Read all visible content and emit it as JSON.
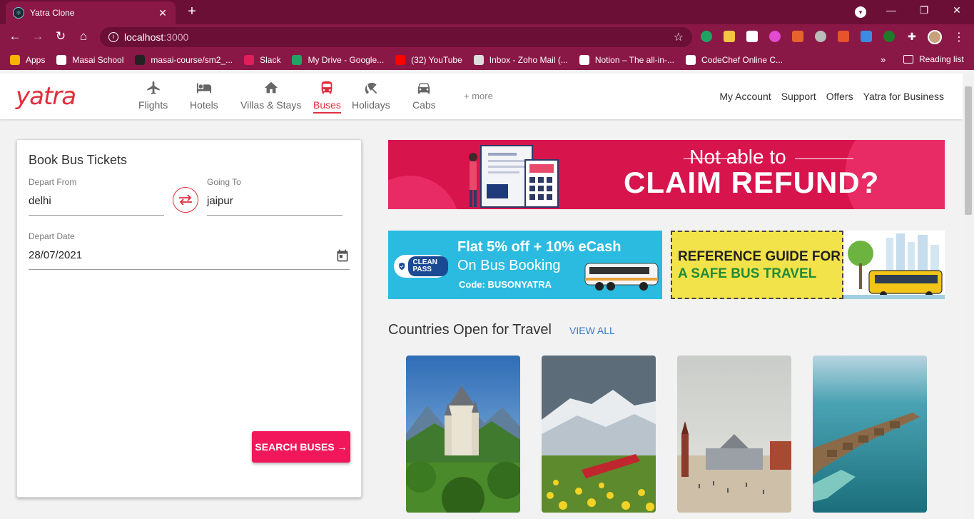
{
  "browser": {
    "tab_title": "Yatra Clone",
    "url_host": "localhost",
    "url_port": ":3000",
    "bookmarks": [
      {
        "label": "Apps",
        "color": "#f4b400"
      },
      {
        "label": "Masai School",
        "color": "#ffffff"
      },
      {
        "label": "masai-course/sm2_...",
        "color": "#222222"
      },
      {
        "label": "Slack",
        "color": "#e01e5a"
      },
      {
        "label": "My Drive - Google...",
        "color": "#1fa463"
      },
      {
        "label": "(32) YouTube",
        "color": "#ff0000"
      },
      {
        "label": "Inbox - Zoho Mail (...",
        "color": "#dddddd"
      },
      {
        "label": "Notion – The all-in-...",
        "color": "#ffffff"
      },
      {
        "label": "CodeChef Online C...",
        "color": "#ffffff"
      }
    ],
    "reading_list": "Reading list",
    "overflow": "»"
  },
  "header": {
    "logo": "yatra",
    "nav": [
      {
        "label": "Flights",
        "icon": "plane-icon"
      },
      {
        "label": "Hotels",
        "icon": "bed-icon"
      },
      {
        "label": "Villas & Stays",
        "icon": "home-icon"
      },
      {
        "label": "Buses",
        "icon": "bus-icon"
      },
      {
        "label": "Holidays",
        "icon": "umbrella-icon"
      },
      {
        "label": "Cabs",
        "icon": "car-icon"
      }
    ],
    "more": "+ more",
    "links": [
      "My Account",
      "Support",
      "Offers",
      "Yatra for Business"
    ]
  },
  "booking": {
    "title": "Book Bus Tickets",
    "from_label": "Depart From",
    "from_value": "delhi",
    "to_label": "Going To",
    "to_value": "jaipur",
    "date_label": "Depart Date",
    "date_value": "28/07/2021",
    "search_label": "SEARCH BUSES →"
  },
  "banners": {
    "refund_line1": "Not able to",
    "refund_line2": "CLAIM REFUND?",
    "offer_line1": "Flat 5% off + 10% eCash",
    "offer_line2": "On Bus Booking",
    "offer_code": "Code: BUSONYATRA",
    "clean_pass": "CLEAN PASS",
    "guide_line1": "REFERENCE GUIDE FOR",
    "guide_line2": "A SAFE BUS TRAVEL"
  },
  "countries": {
    "title": "Countries Open for Travel",
    "view_all": "VIEW ALL"
  },
  "colors": {
    "brand_red": "#e12d3c",
    "cta_pink": "#f2165a",
    "chrome": "#8a1846"
  }
}
